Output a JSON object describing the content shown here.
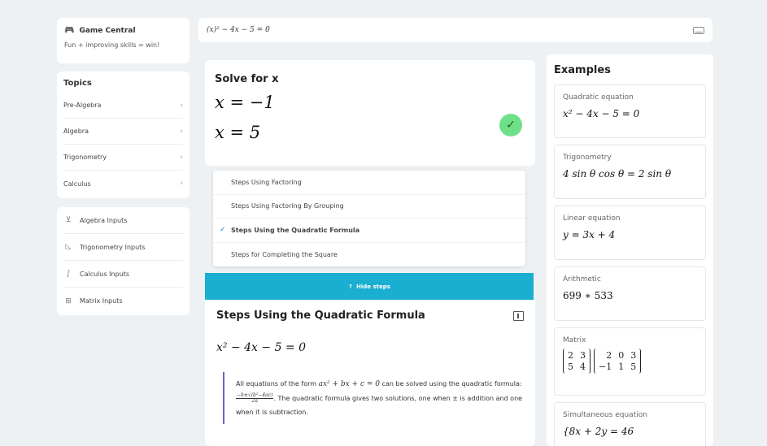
{
  "sidebar": {
    "game": {
      "title": "Game Central",
      "subtitle": "Fun + improving skills = win!"
    },
    "topics": {
      "heading": "Topics",
      "items": [
        {
          "label": "Pre-Algebra"
        },
        {
          "label": "Algebra"
        },
        {
          "label": "Trigonometry"
        },
        {
          "label": "Calculus"
        }
      ]
    },
    "inputs": {
      "items": [
        {
          "label": "Algebra Inputs",
          "icon": "algebra-icon"
        },
        {
          "label": "Trigonometry Inputs",
          "icon": "trig-icon"
        },
        {
          "label": "Calculus Inputs",
          "icon": "calculus-icon"
        },
        {
          "label": "Matrix Inputs",
          "icon": "matrix-icon"
        }
      ]
    }
  },
  "input_bar": {
    "expression": "(x)² − 4x − 5 = 0"
  },
  "solve": {
    "title": "Solve for x",
    "solutions": [
      "x = −1",
      "x = 5"
    ],
    "status": "correct"
  },
  "methods": [
    {
      "label": "Steps Using Factoring",
      "selected": false
    },
    {
      "label": "Steps Using Factoring By Grouping",
      "selected": false
    },
    {
      "label": "Steps Using the Quadratic Formula",
      "selected": true
    },
    {
      "label": "Steps for Completing the Square",
      "selected": false
    }
  ],
  "hide_steps_label": "Hide steps",
  "steps": {
    "title": "Steps Using the Quadratic Formula",
    "equation": "x² − 4x − 5 = 0",
    "explain_part1": "All equations of the form",
    "explain_form": "ax² + bx + c = 0",
    "explain_part2": "can be solved using the quadratic formula:",
    "formula_num": "−b±√(b²−4ac)",
    "formula_den": "2a",
    "explain_part3": ". The quadratic formula gives two solutions, one when ± is addition and one when it is subtraction."
  },
  "examples": {
    "heading": "Examples",
    "items": [
      {
        "category": "Quadratic equation",
        "expr": "x² − 4x − 5 = 0"
      },
      {
        "category": "Trigonometry",
        "expr": "4 sin θ cos θ = 2 sin θ"
      },
      {
        "category": "Linear equation",
        "expr": "y = 3x + 4"
      },
      {
        "category": "Arithmetic",
        "expr": "699 ∗ 533"
      },
      {
        "category": "Matrix"
      },
      {
        "category": "Simultaneous equation",
        "expr": "{8x + 2y = 46"
      }
    ],
    "matrix_a": [
      "2",
      "3",
      "5",
      "4"
    ],
    "matrix_b": [
      "2",
      "0",
      "3",
      "−1",
      "1",
      "5"
    ]
  }
}
